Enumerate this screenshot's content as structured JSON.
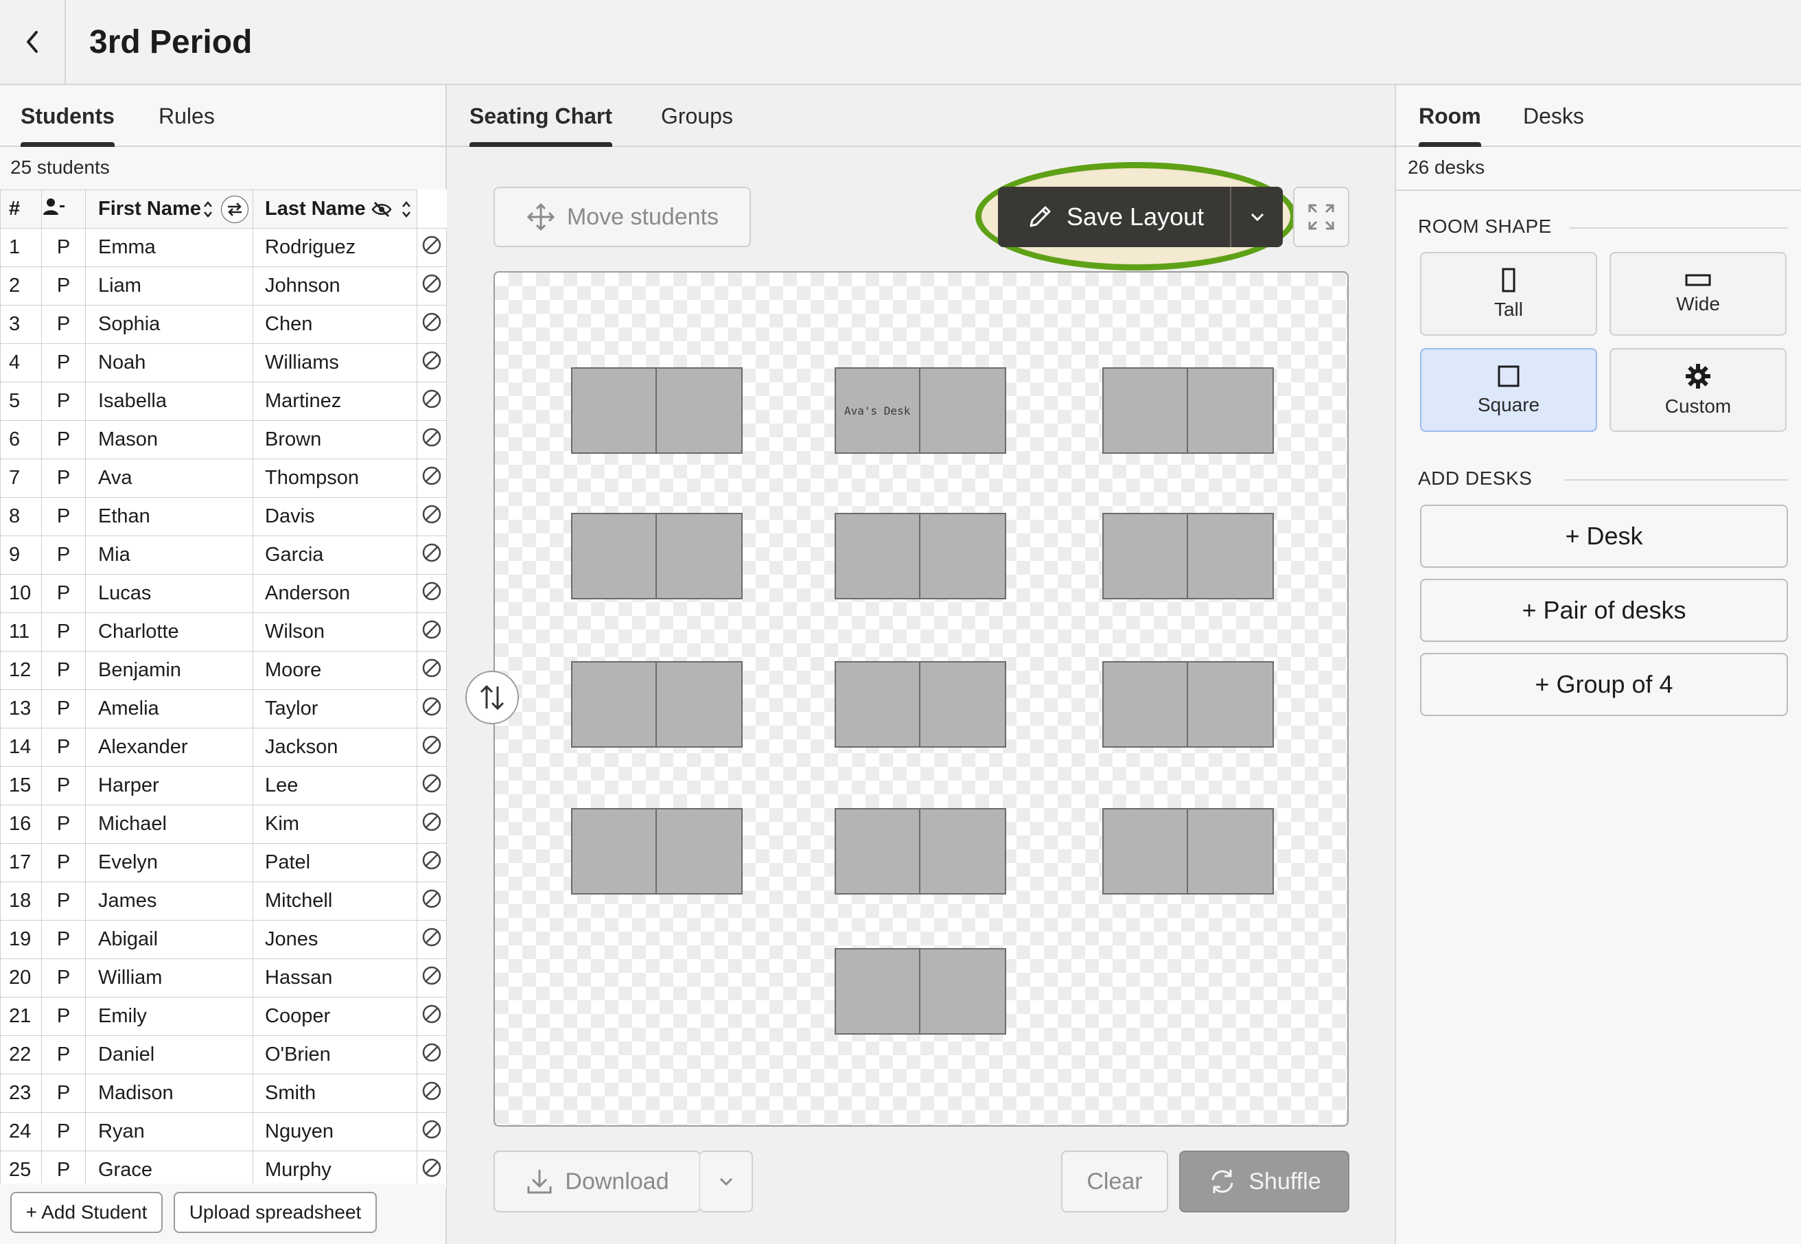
{
  "header": {
    "back_icon": "chevron-left-icon",
    "title": "3rd Period"
  },
  "left": {
    "tabs": [
      {
        "label": "Students",
        "active": true
      },
      {
        "label": "Rules",
        "active": false
      }
    ],
    "count_text": "25 students",
    "columns": {
      "num": "#",
      "first": "First Name",
      "last": "Last Name"
    },
    "students": [
      {
        "n": "1",
        "p": "P",
        "first": "Emma",
        "last": "Rodriguez"
      },
      {
        "n": "2",
        "p": "P",
        "first": "Liam",
        "last": "Johnson"
      },
      {
        "n": "3",
        "p": "P",
        "first": "Sophia",
        "last": "Chen"
      },
      {
        "n": "4",
        "p": "P",
        "first": "Noah",
        "last": "Williams"
      },
      {
        "n": "5",
        "p": "P",
        "first": "Isabella",
        "last": "Martinez"
      },
      {
        "n": "6",
        "p": "P",
        "first": "Mason",
        "last": "Brown"
      },
      {
        "n": "7",
        "p": "P",
        "first": "Ava",
        "last": "Thompson"
      },
      {
        "n": "8",
        "p": "P",
        "first": "Ethan",
        "last": "Davis"
      },
      {
        "n": "9",
        "p": "P",
        "first": "Mia",
        "last": "Garcia"
      },
      {
        "n": "10",
        "p": "P",
        "first": "Lucas",
        "last": "Anderson"
      },
      {
        "n": "11",
        "p": "P",
        "first": "Charlotte",
        "last": "Wilson"
      },
      {
        "n": "12",
        "p": "P",
        "first": "Benjamin",
        "last": "Moore"
      },
      {
        "n": "13",
        "p": "P",
        "first": "Amelia",
        "last": "Taylor"
      },
      {
        "n": "14",
        "p": "P",
        "first": "Alexander",
        "last": "Jackson"
      },
      {
        "n": "15",
        "p": "P",
        "first": "Harper",
        "last": "Lee"
      },
      {
        "n": "16",
        "p": "P",
        "first": "Michael",
        "last": "Kim"
      },
      {
        "n": "17",
        "p": "P",
        "first": "Evelyn",
        "last": "Patel"
      },
      {
        "n": "18",
        "p": "P",
        "first": "James",
        "last": "Mitchell"
      },
      {
        "n": "19",
        "p": "P",
        "first": "Abigail",
        "last": "Jones"
      },
      {
        "n": "20",
        "p": "P",
        "first": "William",
        "last": "Hassan"
      },
      {
        "n": "21",
        "p": "P",
        "first": "Emily",
        "last": "Cooper"
      },
      {
        "n": "22",
        "p": "P",
        "first": "Daniel",
        "last": "O'Brien"
      },
      {
        "n": "23",
        "p": "P",
        "first": "Madison",
        "last": "Smith"
      },
      {
        "n": "24",
        "p": "P",
        "first": "Ryan",
        "last": "Nguyen"
      },
      {
        "n": "25",
        "p": "P",
        "first": "Grace",
        "last": "Murphy"
      }
    ],
    "add_student": "+ Add Student",
    "upload": "Upload spreadsheet"
  },
  "center": {
    "tabs": [
      {
        "label": "Seating Chart",
        "active": true
      },
      {
        "label": "Groups",
        "active": false
      }
    ],
    "move_students": "Move students",
    "save_layout": "Save Layout",
    "desk_label": "Ava's Desk",
    "download": "Download",
    "clear": "Clear",
    "shuffle": "Shuffle",
    "accent_highlight": "#5ea116",
    "desk_pairs": [
      {
        "row": 1,
        "col": 1
      },
      {
        "row": 1,
        "col": 2,
        "label": "Ava's Desk"
      },
      {
        "row": 1,
        "col": 3
      },
      {
        "row": 2,
        "col": 1
      },
      {
        "row": 2,
        "col": 2
      },
      {
        "row": 2,
        "col": 3
      },
      {
        "row": 3,
        "col": 1
      },
      {
        "row": 3,
        "col": 2
      },
      {
        "row": 3,
        "col": 3
      },
      {
        "row": 4,
        "col": 1
      },
      {
        "row": 4,
        "col": 2
      },
      {
        "row": 4,
        "col": 3
      },
      {
        "row": 5,
        "col": 2
      }
    ]
  },
  "right": {
    "tabs": [
      {
        "label": "Room",
        "active": true
      },
      {
        "label": "Desks",
        "active": false
      }
    ],
    "count_text": "26 desks",
    "room_shape_heading": "ROOM SHAPE",
    "shapes": [
      {
        "label": "Tall",
        "icon": "tall-rect-icon",
        "selected": false
      },
      {
        "label": "Wide",
        "icon": "wide-rect-icon",
        "selected": false
      },
      {
        "label": "Square",
        "icon": "square-icon",
        "selected": true
      },
      {
        "label": "Custom",
        "icon": "gear-icon",
        "selected": false
      }
    ],
    "add_desks_heading": "ADD DESKS",
    "add_buttons": [
      "+ Desk",
      "+ Pair of desks",
      "+ Group of 4"
    ]
  }
}
